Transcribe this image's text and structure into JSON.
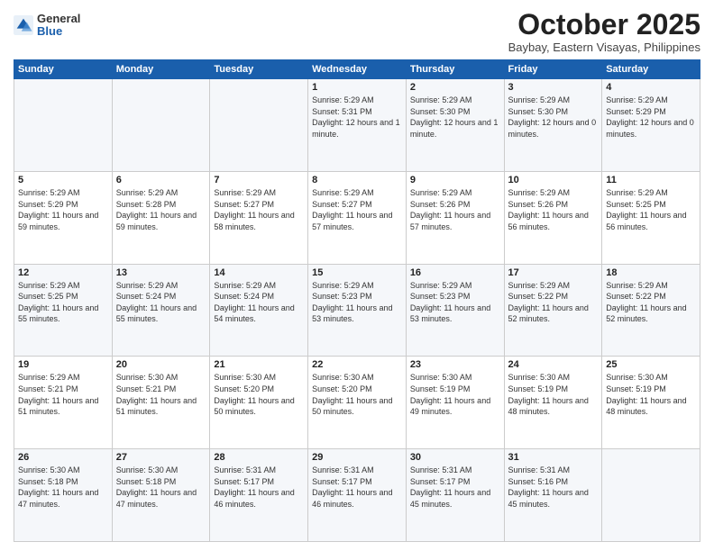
{
  "header": {
    "logo_general": "General",
    "logo_blue": "Blue",
    "month_title": "October 2025",
    "location": "Baybay, Eastern Visayas, Philippines"
  },
  "days_of_week": [
    "Sunday",
    "Monday",
    "Tuesday",
    "Wednesday",
    "Thursday",
    "Friday",
    "Saturday"
  ],
  "weeks": [
    [
      {
        "day": "",
        "sunrise": "",
        "sunset": "",
        "daylight": ""
      },
      {
        "day": "",
        "sunrise": "",
        "sunset": "",
        "daylight": ""
      },
      {
        "day": "",
        "sunrise": "",
        "sunset": "",
        "daylight": ""
      },
      {
        "day": "1",
        "sunrise": "Sunrise: 5:29 AM",
        "sunset": "Sunset: 5:31 PM",
        "daylight": "Daylight: 12 hours and 1 minute."
      },
      {
        "day": "2",
        "sunrise": "Sunrise: 5:29 AM",
        "sunset": "Sunset: 5:30 PM",
        "daylight": "Daylight: 12 hours and 1 minute."
      },
      {
        "day": "3",
        "sunrise": "Sunrise: 5:29 AM",
        "sunset": "Sunset: 5:30 PM",
        "daylight": "Daylight: 12 hours and 0 minutes."
      },
      {
        "day": "4",
        "sunrise": "Sunrise: 5:29 AM",
        "sunset": "Sunset: 5:29 PM",
        "daylight": "Daylight: 12 hours and 0 minutes."
      }
    ],
    [
      {
        "day": "5",
        "sunrise": "Sunrise: 5:29 AM",
        "sunset": "Sunset: 5:29 PM",
        "daylight": "Daylight: 11 hours and 59 minutes."
      },
      {
        "day": "6",
        "sunrise": "Sunrise: 5:29 AM",
        "sunset": "Sunset: 5:28 PM",
        "daylight": "Daylight: 11 hours and 59 minutes."
      },
      {
        "day": "7",
        "sunrise": "Sunrise: 5:29 AM",
        "sunset": "Sunset: 5:27 PM",
        "daylight": "Daylight: 11 hours and 58 minutes."
      },
      {
        "day": "8",
        "sunrise": "Sunrise: 5:29 AM",
        "sunset": "Sunset: 5:27 PM",
        "daylight": "Daylight: 11 hours and 57 minutes."
      },
      {
        "day": "9",
        "sunrise": "Sunrise: 5:29 AM",
        "sunset": "Sunset: 5:26 PM",
        "daylight": "Daylight: 11 hours and 57 minutes."
      },
      {
        "day": "10",
        "sunrise": "Sunrise: 5:29 AM",
        "sunset": "Sunset: 5:26 PM",
        "daylight": "Daylight: 11 hours and 56 minutes."
      },
      {
        "day": "11",
        "sunrise": "Sunrise: 5:29 AM",
        "sunset": "Sunset: 5:25 PM",
        "daylight": "Daylight: 11 hours and 56 minutes."
      }
    ],
    [
      {
        "day": "12",
        "sunrise": "Sunrise: 5:29 AM",
        "sunset": "Sunset: 5:25 PM",
        "daylight": "Daylight: 11 hours and 55 minutes."
      },
      {
        "day": "13",
        "sunrise": "Sunrise: 5:29 AM",
        "sunset": "Sunset: 5:24 PM",
        "daylight": "Daylight: 11 hours and 55 minutes."
      },
      {
        "day": "14",
        "sunrise": "Sunrise: 5:29 AM",
        "sunset": "Sunset: 5:24 PM",
        "daylight": "Daylight: 11 hours and 54 minutes."
      },
      {
        "day": "15",
        "sunrise": "Sunrise: 5:29 AM",
        "sunset": "Sunset: 5:23 PM",
        "daylight": "Daylight: 11 hours and 53 minutes."
      },
      {
        "day": "16",
        "sunrise": "Sunrise: 5:29 AM",
        "sunset": "Sunset: 5:23 PM",
        "daylight": "Daylight: 11 hours and 53 minutes."
      },
      {
        "day": "17",
        "sunrise": "Sunrise: 5:29 AM",
        "sunset": "Sunset: 5:22 PM",
        "daylight": "Daylight: 11 hours and 52 minutes."
      },
      {
        "day": "18",
        "sunrise": "Sunrise: 5:29 AM",
        "sunset": "Sunset: 5:22 PM",
        "daylight": "Daylight: 11 hours and 52 minutes."
      }
    ],
    [
      {
        "day": "19",
        "sunrise": "Sunrise: 5:29 AM",
        "sunset": "Sunset: 5:21 PM",
        "daylight": "Daylight: 11 hours and 51 minutes."
      },
      {
        "day": "20",
        "sunrise": "Sunrise: 5:30 AM",
        "sunset": "Sunset: 5:21 PM",
        "daylight": "Daylight: 11 hours and 51 minutes."
      },
      {
        "day": "21",
        "sunrise": "Sunrise: 5:30 AM",
        "sunset": "Sunset: 5:20 PM",
        "daylight": "Daylight: 11 hours and 50 minutes."
      },
      {
        "day": "22",
        "sunrise": "Sunrise: 5:30 AM",
        "sunset": "Sunset: 5:20 PM",
        "daylight": "Daylight: 11 hours and 50 minutes."
      },
      {
        "day": "23",
        "sunrise": "Sunrise: 5:30 AM",
        "sunset": "Sunset: 5:19 PM",
        "daylight": "Daylight: 11 hours and 49 minutes."
      },
      {
        "day": "24",
        "sunrise": "Sunrise: 5:30 AM",
        "sunset": "Sunset: 5:19 PM",
        "daylight": "Daylight: 11 hours and 48 minutes."
      },
      {
        "day": "25",
        "sunrise": "Sunrise: 5:30 AM",
        "sunset": "Sunset: 5:19 PM",
        "daylight": "Daylight: 11 hours and 48 minutes."
      }
    ],
    [
      {
        "day": "26",
        "sunrise": "Sunrise: 5:30 AM",
        "sunset": "Sunset: 5:18 PM",
        "daylight": "Daylight: 11 hours and 47 minutes."
      },
      {
        "day": "27",
        "sunrise": "Sunrise: 5:30 AM",
        "sunset": "Sunset: 5:18 PM",
        "daylight": "Daylight: 11 hours and 47 minutes."
      },
      {
        "day": "28",
        "sunrise": "Sunrise: 5:31 AM",
        "sunset": "Sunset: 5:17 PM",
        "daylight": "Daylight: 11 hours and 46 minutes."
      },
      {
        "day": "29",
        "sunrise": "Sunrise: 5:31 AM",
        "sunset": "Sunset: 5:17 PM",
        "daylight": "Daylight: 11 hours and 46 minutes."
      },
      {
        "day": "30",
        "sunrise": "Sunrise: 5:31 AM",
        "sunset": "Sunset: 5:17 PM",
        "daylight": "Daylight: 11 hours and 45 minutes."
      },
      {
        "day": "31",
        "sunrise": "Sunrise: 5:31 AM",
        "sunset": "Sunset: 5:16 PM",
        "daylight": "Daylight: 11 hours and 45 minutes."
      },
      {
        "day": "",
        "sunrise": "",
        "sunset": "",
        "daylight": ""
      }
    ]
  ]
}
